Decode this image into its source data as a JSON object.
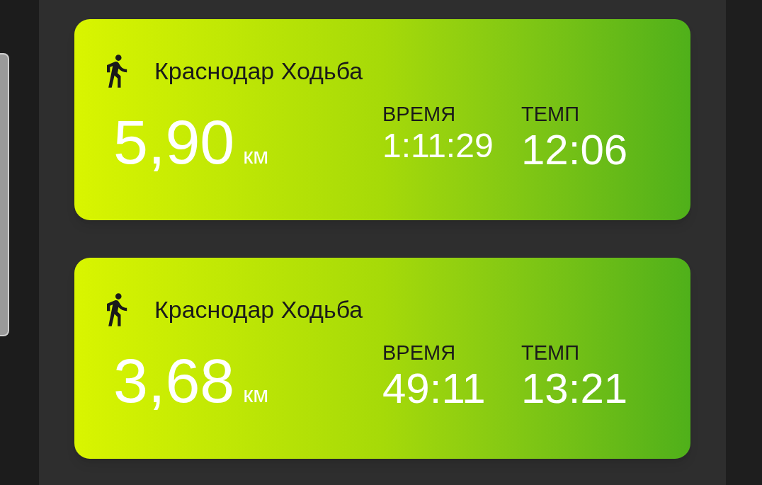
{
  "activities": [
    {
      "title": "Краснодар Ходьба",
      "distance": "5,90",
      "unit": "км",
      "time_label": "ВРЕМЯ",
      "time": "1:11:29",
      "pace_label": "ТЕМП",
      "pace": "12:06"
    },
    {
      "title": "Краснодар Ходьба",
      "distance": "3,68",
      "unit": "км",
      "time_label": "ВРЕМЯ",
      "time": "49:11",
      "pace_label": "ТЕМП",
      "pace": "13:21"
    }
  ]
}
